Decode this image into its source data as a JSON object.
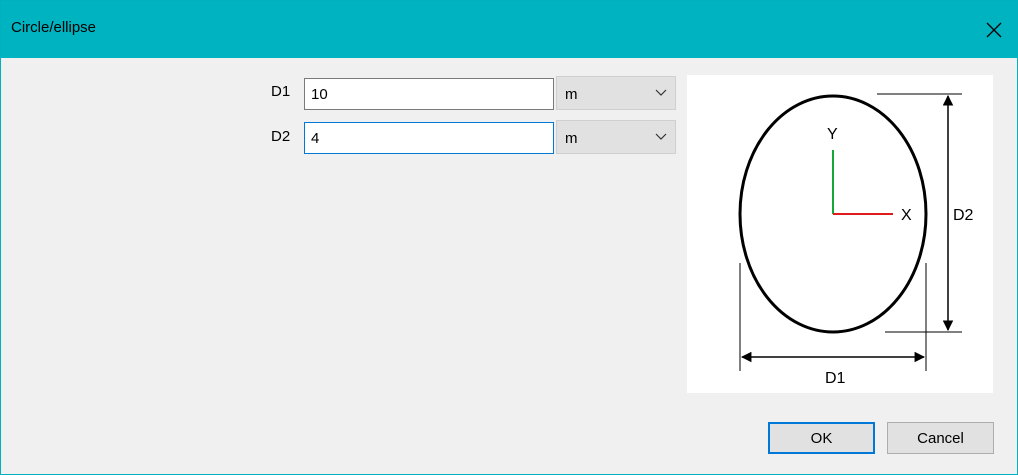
{
  "window": {
    "title": "Circle/ellipse"
  },
  "fields": [
    {
      "label": "D1",
      "value": "10",
      "unit": "m"
    },
    {
      "label": "D2",
      "value": "4",
      "unit": "m"
    }
  ],
  "diagram": {
    "axis_y": "Y",
    "axis_x": "X",
    "dim_vertical": "D2",
    "dim_horizontal": "D1"
  },
  "buttons": {
    "ok": "OK",
    "cancel": "Cancel"
  },
  "colors": {
    "titlebar": "#00b3c0",
    "focus": "#0078d7",
    "x_axis": "#e01b1b",
    "y_axis": "#12a83a"
  },
  "icons": [
    "close-icon",
    "chevron-down-icon"
  ]
}
